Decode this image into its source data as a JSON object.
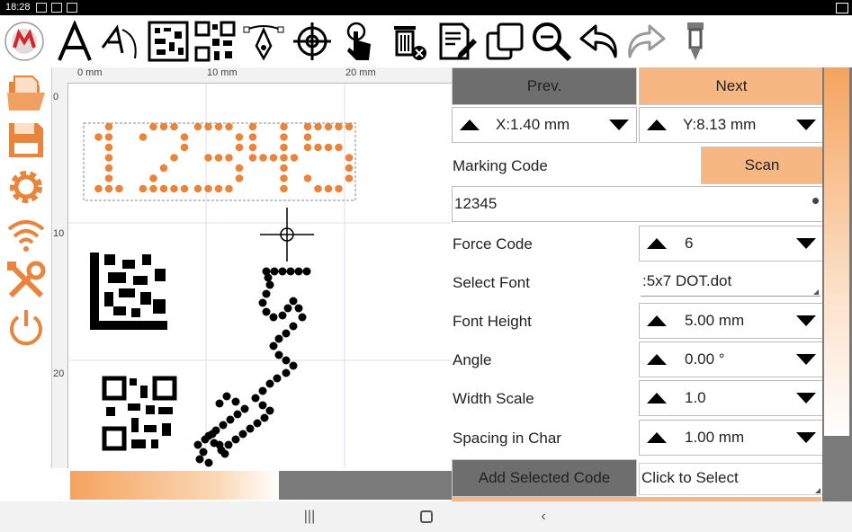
{
  "status_bar": {
    "time": "18:28"
  },
  "toolbar": {
    "tools": [
      "text-tool",
      "arc-text-tool",
      "datamatrix-tool",
      "qrcode-tool",
      "bezier-tool",
      "center-target-tool",
      "touch-select-tool",
      "delete-tool",
      "edit-document-tool",
      "copy-tool",
      "zoom-tool",
      "undo-tool",
      "redo-tool",
      "stamp-tool"
    ]
  },
  "sidebar": {
    "items": [
      "open-folder",
      "save",
      "settings",
      "wireless",
      "tools",
      "power"
    ]
  },
  "canvas": {
    "ruler_h": [
      "0 mm",
      "10 mm",
      "20 mm"
    ],
    "ruler_v": [
      "0",
      "10",
      "20"
    ],
    "marking_text": "12345",
    "curved_text": "SHE5"
  },
  "panel": {
    "prev_label": "Prev.",
    "next_label": "Next",
    "x_value": "X:1.40 mm",
    "y_value": "Y:8.13 mm",
    "marking_code_label": "Marking Code",
    "scan_label": "Scan",
    "code_value": "12345",
    "force_code_label": "Force Code",
    "force_code_value": "6",
    "select_font_label": "Select Font",
    "font_value": ":5x7 DOT.dot",
    "font_height_label": "Font Height",
    "font_height_value": "5.00 mm",
    "angle_label": "Angle",
    "angle_value": "0.00 °",
    "width_scale_label": "Width Scale",
    "width_scale_value": "1.0",
    "spacing_label": "Spacing in Char",
    "spacing_value": "1.00 mm",
    "add_code_label": "Add Selected Code",
    "click_select": "Click to Select"
  },
  "colors": {
    "accent": "#f7b783",
    "dot_orange": "#e8843c",
    "gray_button": "#6e6e6e"
  }
}
